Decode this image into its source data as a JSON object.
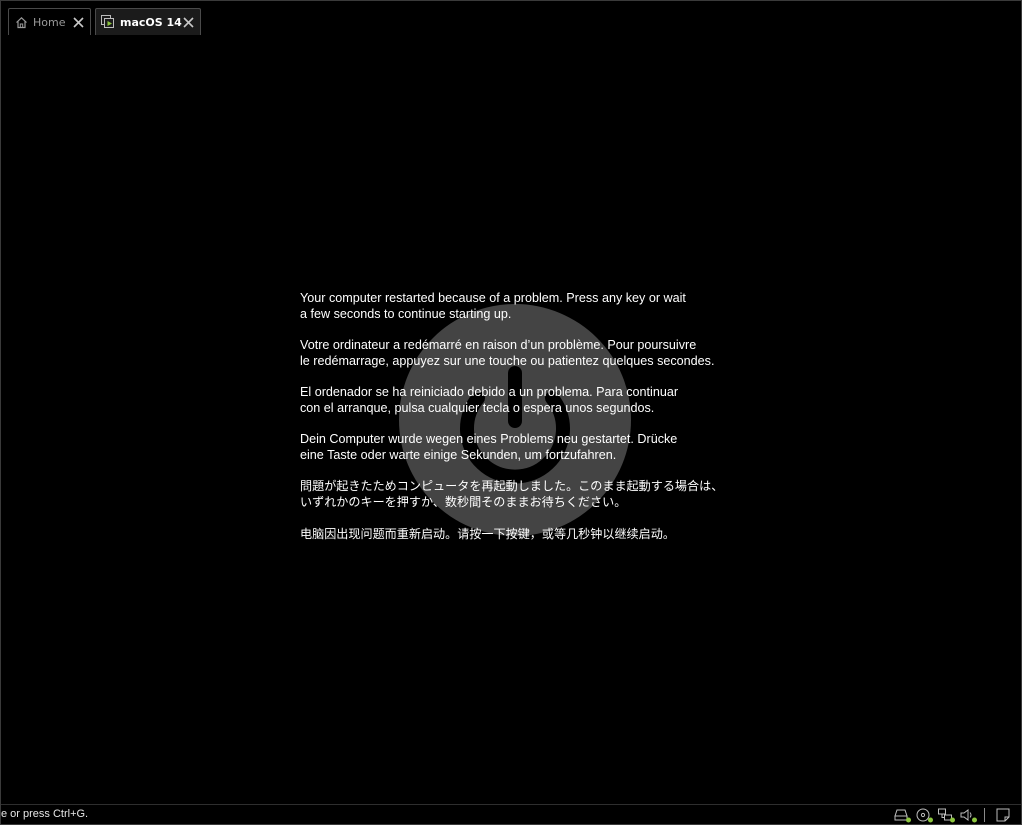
{
  "tabs": [
    {
      "label": "Home",
      "icon": "home-icon",
      "active": false
    },
    {
      "label": "macOS 14",
      "icon": "vm-running-icon",
      "active": true
    }
  ],
  "screen": {
    "background": "#000000",
    "logo_icon": "power-icon",
    "messages": [
      "Your computer restarted because of a problem. Press any key or wait\na few seconds to continue starting up.",
      "Votre ordinateur a redémarré en raison d’un problème. Pour poursuivre\nle redémarrage, appuyez sur une touche ou patientez quelques secondes.",
      "El ordenador se ha reiniciado debido a un problema. Para continuar\ncon el arranque, pulsa cualquier tecla o espera unos segundos.",
      "Dein Computer wurde wegen eines Problems neu gestartet. Drücke\neine Taste oder warte einige Sekunden, um fortzufahren.",
      "問題が起きたためコンピュータを再起動しました。このまま起動する場合は、\nいずれかのキーを押すか、数秒間そのままお待ちください。",
      "电脑因出现问题而重新启动。请按一下按键，或等几秒钟以继续启动。"
    ]
  },
  "statusbar": {
    "text": "e or press Ctrl+G.",
    "tray_icons": [
      "hard-disk-icon",
      "cd-dvd-icon",
      "network-icon",
      "sound-icon",
      "message-log-icon"
    ],
    "accent": "#8dc63f"
  }
}
